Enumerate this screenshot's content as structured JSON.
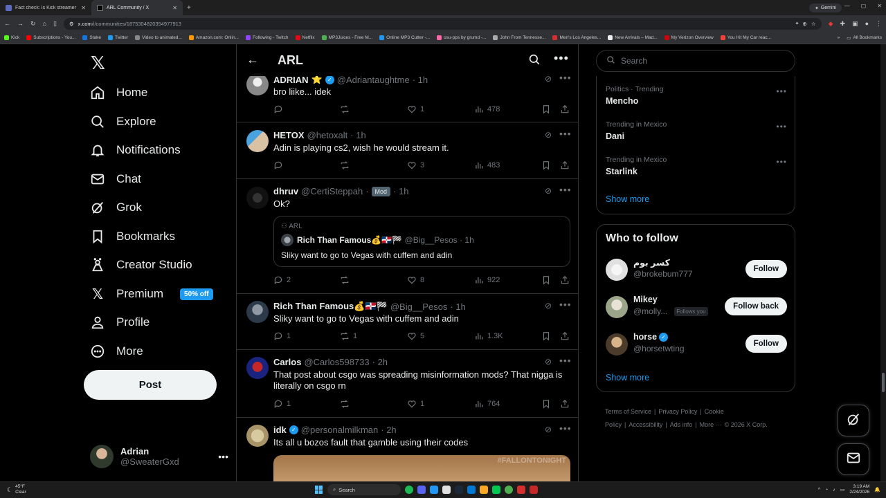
{
  "browser": {
    "tabs": [
      {
        "title": "Fact check: Is Kick streamer Ch",
        "active": false
      },
      {
        "title": "ARL Community / X",
        "active": true
      }
    ],
    "gemini_label": "Gemini",
    "url": "x.com",
    "url_path": "/i/communities/1875304820354977913",
    "bookmarks": [
      "Kick",
      "Subscriptions - You...",
      "Stake",
      "Twitter",
      "Video to animated...",
      "Amazon.com: Onlin...",
      "Following - Twitch",
      "Netflix",
      "MP3Juices - Free M...",
      "Online MP3 Cutter -...",
      "osu-pps by grumd -...",
      "John From Tennesse...",
      "Men's Los Angeles...",
      "New Arrivals – Mad...",
      "My Verizon Overview",
      "You Hit My Car reac..."
    ],
    "all_bookmarks": "All Bookmarks"
  },
  "nav": {
    "items": [
      {
        "label": "Home",
        "icon": "home-icon"
      },
      {
        "label": "Explore",
        "icon": "search-icon"
      },
      {
        "label": "Notifications",
        "icon": "bell-icon"
      },
      {
        "label": "Chat",
        "icon": "mail-icon"
      },
      {
        "label": "Grok",
        "icon": "grok-icon"
      },
      {
        "label": "Bookmarks",
        "icon": "bookmark-icon"
      },
      {
        "label": "Creator Studio",
        "icon": "creator-icon"
      },
      {
        "label": "Premium",
        "icon": "x-icon"
      },
      {
        "label": "Profile",
        "icon": "person-icon"
      },
      {
        "label": "More",
        "icon": "more-circle-icon"
      }
    ],
    "premium_badge": "50% off",
    "post_label": "Post",
    "me": {
      "name": "Adrian",
      "handle": "@SweaterGxd"
    }
  },
  "header": {
    "title": "ARL"
  },
  "posts": [
    {
      "name": "ADRIAN",
      "emoji": "⭐",
      "verified": true,
      "handle": "@Adriantaughtme",
      "time": "· 1h",
      "text": "bro liike... idek",
      "replies": "",
      "reposts": "",
      "likes": "1",
      "views": "478"
    },
    {
      "name": "HETOX",
      "emoji": "",
      "verified": false,
      "handle": "@hetoxalt",
      "time": "· 1h",
      "text": "Adin is playing cs2, wish he would stream it.",
      "replies": "",
      "reposts": "",
      "likes": "3",
      "views": "483"
    },
    {
      "name": "dhruv",
      "emoji": "",
      "verified": false,
      "handle": "@CertiSteppah",
      "mod": "Mod",
      "time": "· 1h",
      "text": "Ok?",
      "replies": "2",
      "reposts": "",
      "likes": "8",
      "views": "922",
      "quote": {
        "community": "ARL",
        "name": "Rich Than Famous💰🇩🇴🏁",
        "handle": "@Big__Pesos",
        "time": "· 1h",
        "text": "Sliky want to go to Vegas with cuffem and adin"
      }
    },
    {
      "name": "Rich Than Famous💰🇩🇴🏁",
      "emoji": "",
      "verified": false,
      "handle": "@Big__Pesos",
      "time": "· 1h",
      "text": "Sliky want to go to Vegas with cuffem and adin",
      "replies": "1",
      "reposts": "1",
      "likes": "5",
      "views": "1.3K"
    },
    {
      "name": "Carlos",
      "emoji": "",
      "verified": false,
      "handle": "@Carlos598733",
      "time": "· 2h",
      "text": "That post about csgo was spreading misinformation mods? That nigga is literally on csgo rn",
      "replies": "1",
      "reposts": "",
      "likes": "1",
      "views": "764"
    },
    {
      "name": "idk",
      "emoji": "",
      "verified": true,
      "handle": "@personalmilkman",
      "time": "· 2h",
      "text": "Its all u bozos fault that gamble using their codes",
      "media_text": "#FALLONTONIGHT"
    }
  ],
  "search": {
    "placeholder": "Search"
  },
  "trends": [
    {
      "meta": "Politics · Trending",
      "name": "Mencho"
    },
    {
      "meta": "Trending in Mexico",
      "name": "Dani"
    },
    {
      "meta": "Trending in Mexico",
      "name": "Starlink"
    }
  ],
  "show_more": "Show more",
  "who_to_follow": {
    "title": "Who to follow",
    "accounts": [
      {
        "name": "كسر بوم",
        "handle": "@brokebum777",
        "button": "Follow",
        "follows_you": ""
      },
      {
        "name": "Mikey",
        "handle": "@molly...",
        "button": "Follow back",
        "follows_you": "Follows you"
      },
      {
        "name": "horse",
        "handle": "@horsetwting",
        "button": "Follow",
        "follows_you": "",
        "verified": true
      }
    ],
    "show_more": "Show more"
  },
  "footer": {
    "links": [
      "Terms of Service",
      "|",
      "Privacy Policy",
      "|",
      "Cookie Policy",
      "|",
      "Accessibility",
      "|",
      "Ads info",
      "|",
      "More ···",
      "© 2026 X Corp."
    ]
  },
  "taskbar": {
    "temp": "45°F",
    "condition": "Clear",
    "search": "Search",
    "time": "3:19 AM",
    "date": "2/24/2026"
  },
  "colors": {
    "accent": "#1d9bf0",
    "bg": "#000000",
    "border": "#2f3336",
    "muted": "#71767b"
  }
}
